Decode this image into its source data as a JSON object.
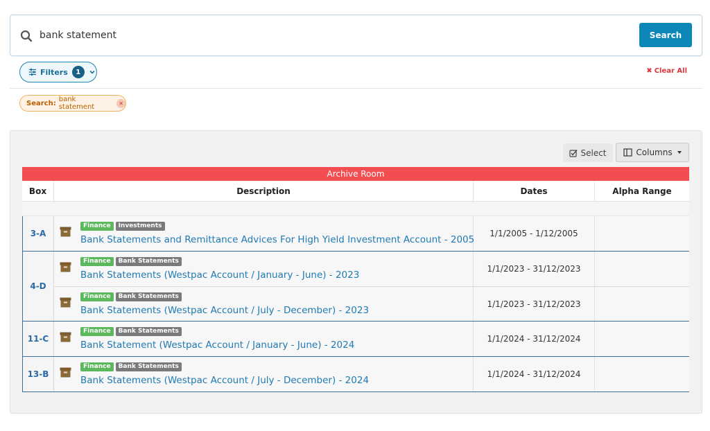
{
  "search": {
    "value": "bank statement",
    "button_label": "Search"
  },
  "filters": {
    "label": "Filters",
    "count": "1",
    "clear_all_label": "Clear All"
  },
  "chip": {
    "key": "Search:",
    "value": "bank statement"
  },
  "toolbar": {
    "select_label": "Select",
    "columns_label": "Columns"
  },
  "table": {
    "group_header": "Archive Room",
    "columns": {
      "box": "Box",
      "description": "Description",
      "dates": "Dates",
      "alpha": "Alpha Range"
    },
    "groups": [
      {
        "box": "3-A",
        "rows": [
          {
            "tags": [
              "Finance",
              "Investments"
            ],
            "description": "Bank Statements and Remittance Advices For High Yield Investment Account - 2005",
            "dates": "1/1/2005 - 1/12/2005",
            "alpha": ""
          }
        ]
      },
      {
        "box": "4-D",
        "rows": [
          {
            "tags": [
              "Finance",
              "Bank Statements"
            ],
            "description": "Bank Statements (Westpac Account / January - June) - 2023",
            "dates": "1/1/2023 - 31/12/2023",
            "alpha": ""
          },
          {
            "tags": [
              "Finance",
              "Bank Statements"
            ],
            "description": "Bank Statements (Westpac Account / July - December) - 2023",
            "dates": "1/1/2023 - 31/12/2023",
            "alpha": ""
          }
        ]
      },
      {
        "box": "11-C",
        "rows": [
          {
            "tags": [
              "Finance",
              "Bank Statements"
            ],
            "description": "Bank Statement (Westpac Account / January - June) - 2024",
            "dates": "1/1/2024 - 31/12/2024",
            "alpha": ""
          }
        ]
      },
      {
        "box": "13-B",
        "rows": [
          {
            "tags": [
              "Finance",
              "Bank Statements"
            ],
            "description": "Bank Statements (Westpac Account / July - December) - 2024",
            "dates": "1/1/2024 - 31/12/2024",
            "alpha": ""
          }
        ]
      }
    ]
  },
  "colors": {
    "primary": "#0d86b8",
    "danger": "#d9363e",
    "archive_header": "#f24e52",
    "tag_finance": "#5cb85c",
    "tag_category": "#7a7a7a",
    "link": "#1f7ab3"
  }
}
